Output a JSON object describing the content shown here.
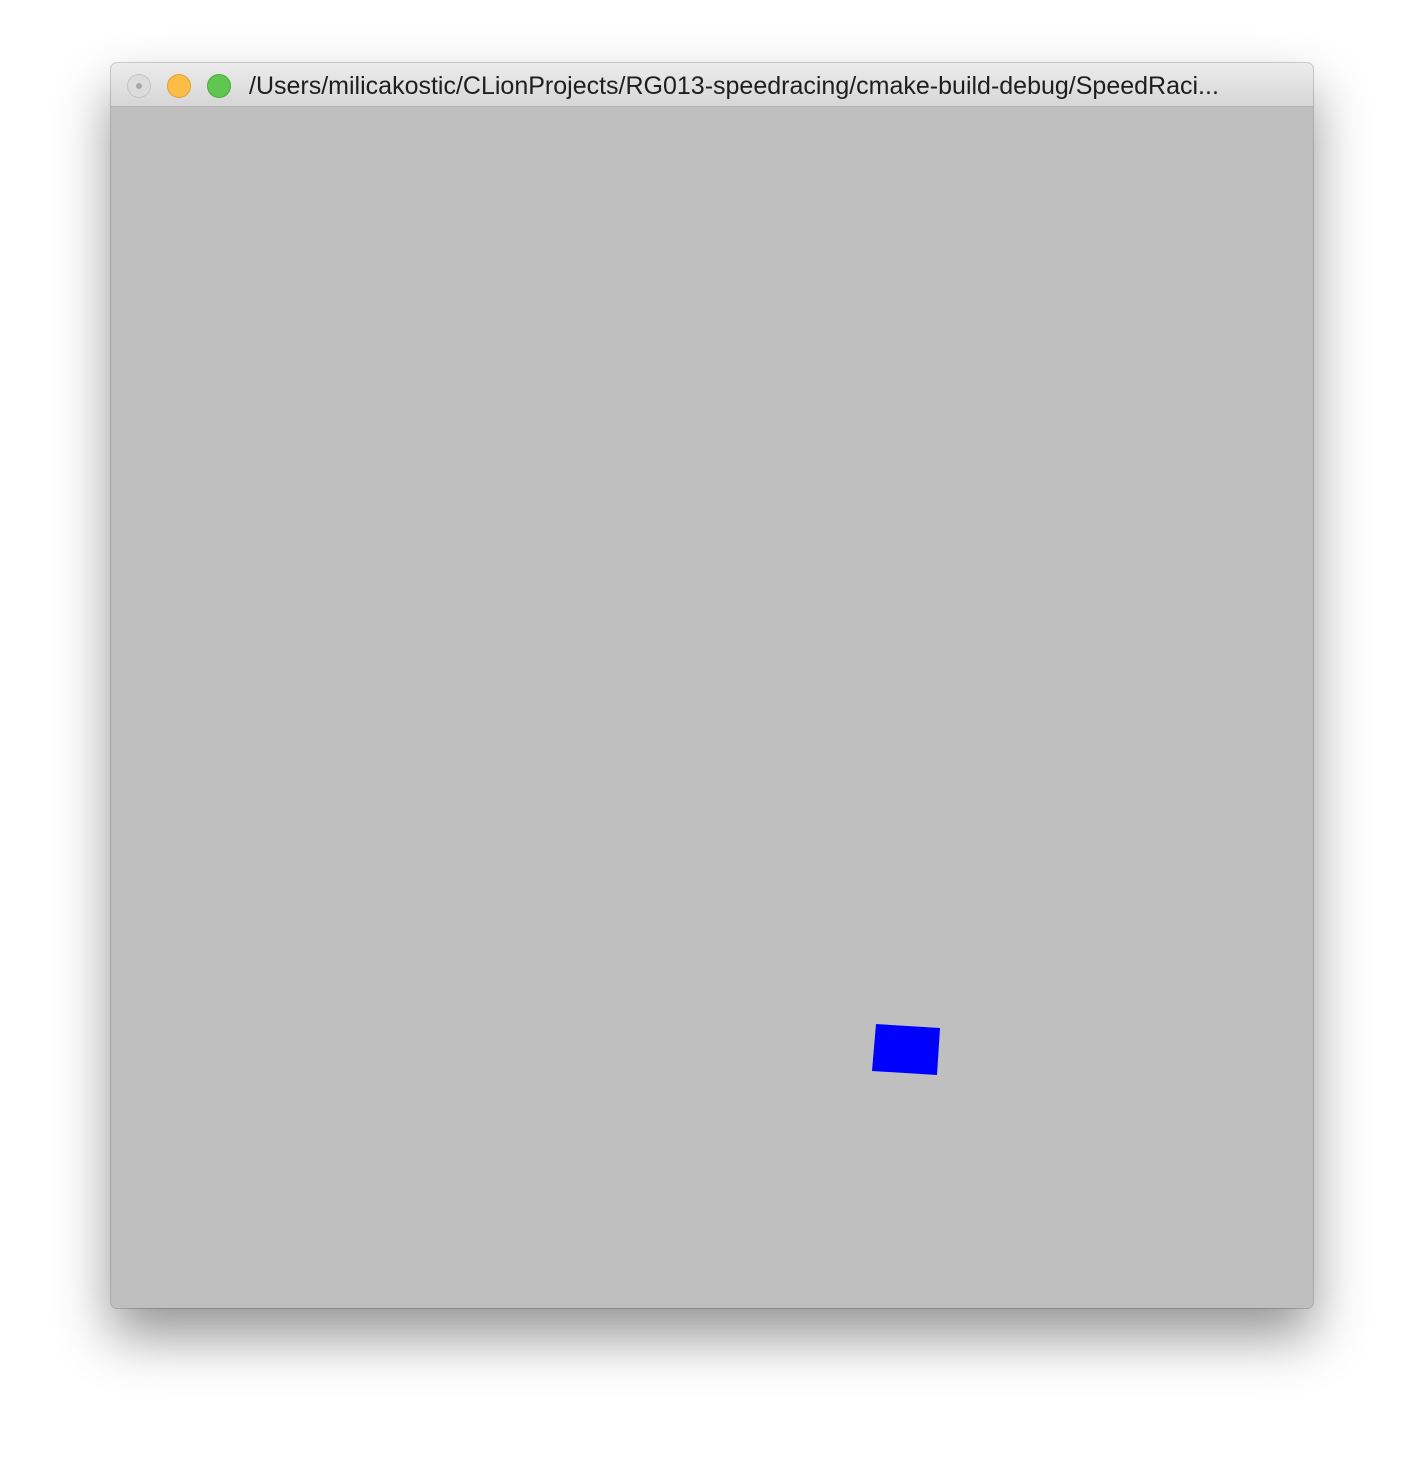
{
  "window": {
    "title": "/Users/milicakostic/CLionProjects/RG013-speedracing/cmake-build-debug/SpeedRaci..."
  },
  "titlebar": {
    "buttons": [
      {
        "name": "close-button",
        "icon": "close-icon",
        "color": "#dcdcdc",
        "state": "inactive"
      },
      {
        "name": "minimize-button",
        "icon": "minimize-icon",
        "color": "#fbbd46"
      },
      {
        "name": "zoom-button",
        "icon": "zoom-icon",
        "color": "#5fc74f"
      }
    ]
  },
  "scene": {
    "background_color": "#bfbfbf",
    "objects": [
      {
        "name": "player-car",
        "shape": "quadrilateral",
        "color": "#0000ff"
      }
    ]
  }
}
